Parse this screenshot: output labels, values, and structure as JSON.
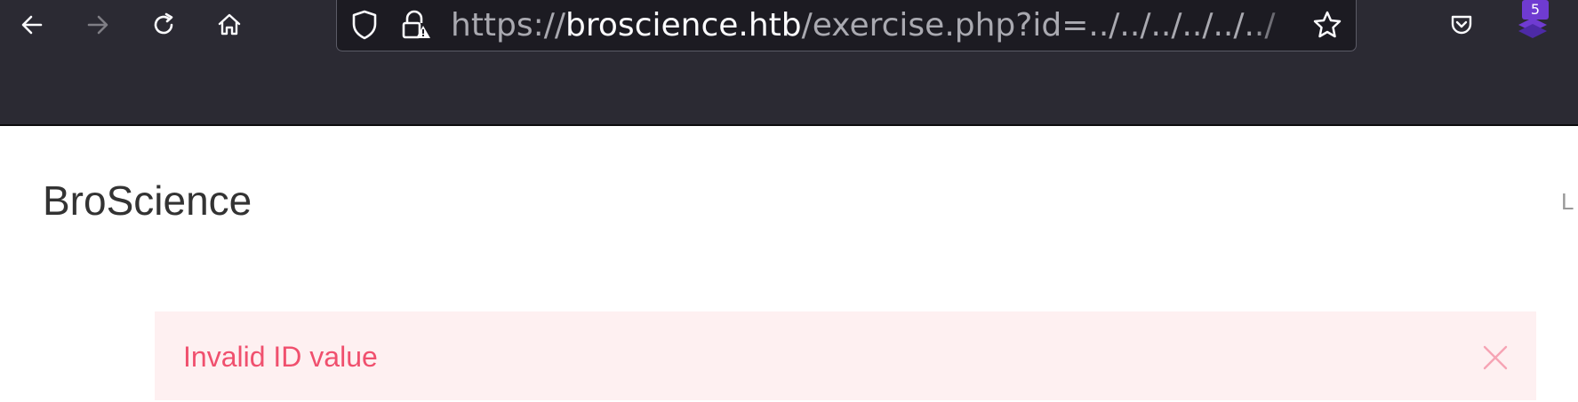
{
  "browser": {
    "url": {
      "scheme": "https://",
      "host": "broscience.htb",
      "path": "/exercise.php?id=../../../../../../"
    },
    "extension_badge": "5"
  },
  "page": {
    "brand": "BroScience",
    "nav_partial": "L",
    "alert": {
      "message": "Invalid ID value",
      "type": "danger",
      "color": "#f0506e",
      "background": "#fef0f1"
    }
  }
}
